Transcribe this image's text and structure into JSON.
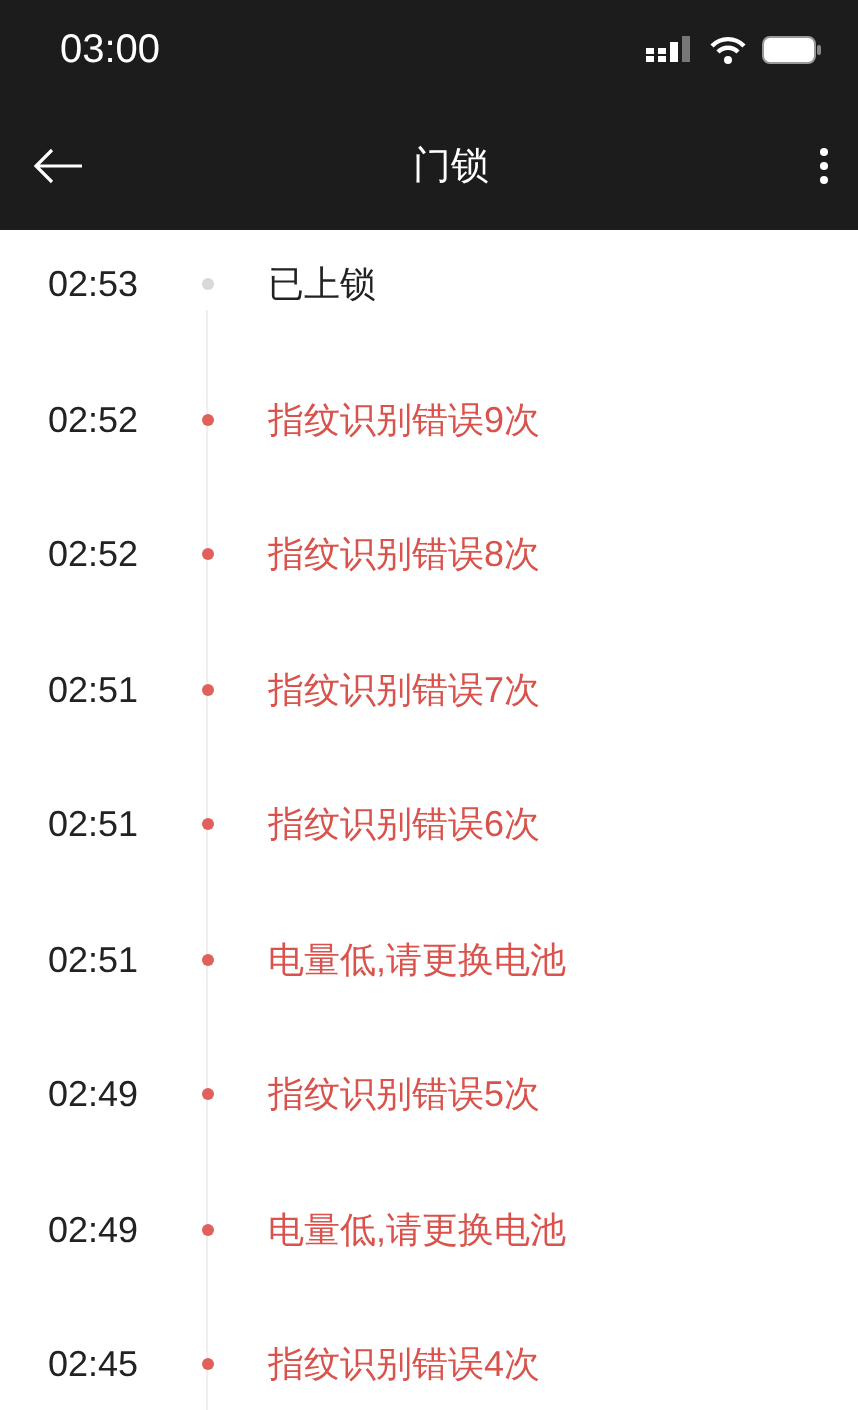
{
  "status_bar": {
    "time": "03:00"
  },
  "nav_bar": {
    "title": "门锁"
  },
  "events": [
    {
      "time": "02:53",
      "text": "已上锁",
      "kind": "normal"
    },
    {
      "time": "02:52",
      "text": "指纹识别错误9次",
      "kind": "alert"
    },
    {
      "time": "02:52",
      "text": "指纹识别错误8次",
      "kind": "alert"
    },
    {
      "time": "02:51",
      "text": "指纹识别错误7次",
      "kind": "alert"
    },
    {
      "time": "02:51",
      "text": "指纹识别错误6次",
      "kind": "alert"
    },
    {
      "time": "02:51",
      "text": "电量低,请更换电池",
      "kind": "alert"
    },
    {
      "time": "02:49",
      "text": "指纹识别错误5次",
      "kind": "alert"
    },
    {
      "time": "02:49",
      "text": "电量低,请更换电池",
      "kind": "alert"
    },
    {
      "time": "02:45",
      "text": "指纹识别错误4次",
      "kind": "alert"
    }
  ]
}
